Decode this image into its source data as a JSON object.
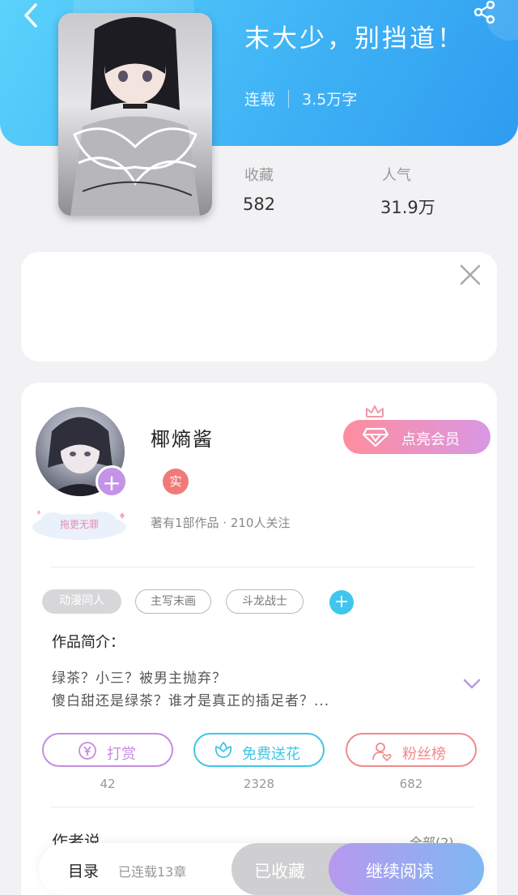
{
  "book": {
    "title": "末大少，别挡道！",
    "status": "连载",
    "word_count": "3.5万字",
    "stats": {
      "favorites_label": "收藏",
      "favorites_value": "582",
      "popularity_label": "人气",
      "popularity_value": "31.9万"
    }
  },
  "author": {
    "name": "椰熵酱",
    "badge_text": "实",
    "stats": "著有1部作品 · 210人关注",
    "vip_button": "点亮会员",
    "fan_badge": "拖更无罪"
  },
  "tags": [
    "动漫同人",
    "主写末画",
    "斗龙战士"
  ],
  "intro": {
    "label": "作品简介：",
    "line1": "绿茶？小三？被男主抛弃？",
    "line2": "傻白甜还是绿茶？谁才是真正的插足者？..."
  },
  "actions": [
    {
      "label": "打赏",
      "count": "42",
      "color": "#c58ce0"
    },
    {
      "label": "免费送花",
      "count": "2328",
      "color": "#3fc6e6"
    },
    {
      "label": "粉丝榜",
      "count": "682",
      "color": "#ef8b8b"
    }
  ],
  "author_says": {
    "label": "作者说",
    "all_link": "全部(2)"
  },
  "bottom_bar": {
    "catalog": "目录",
    "chapters": "已连载13章",
    "collected": "已收藏",
    "continue_read": "继续阅读"
  },
  "colors": {
    "header_gradient_start": "#5ad2fb",
    "header_gradient_end": "#2f9cf0",
    "vip_gradient_start": "#ff8c9e",
    "vip_gradient_end": "#d898e4"
  },
  "icons": {
    "back": "back-arrow-icon",
    "share": "share-icon",
    "close": "close-icon",
    "add": "plus-icon",
    "expand": "chevron-down-icon",
    "reward": "yen-coin-icon",
    "flower": "flower-icon",
    "fans": "user-heart-icon",
    "vip": "diamond-icon"
  }
}
